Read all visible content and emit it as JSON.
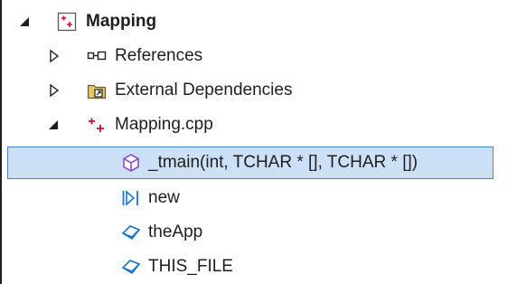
{
  "tree": {
    "items": [
      {
        "label": "Mapping",
        "icon": "cpp-project-icon",
        "expander": "expanded"
      },
      {
        "label": "References",
        "icon": "references-icon",
        "expander": "collapsed"
      },
      {
        "label": "External Dependencies",
        "icon": "external-dependencies-icon",
        "expander": "collapsed"
      },
      {
        "label": "Mapping.cpp",
        "icon": "cpp-file-icon",
        "expander": "expanded"
      },
      {
        "label": "_tmain(int, TCHAR * [], TCHAR * [])",
        "icon": "function-icon",
        "selected": true
      },
      {
        "label": "new",
        "icon": "operator-icon"
      },
      {
        "label": "theApp",
        "icon": "variable-icon"
      },
      {
        "label": "THIS_FILE",
        "icon": "variable-icon"
      }
    ]
  },
  "colors": {
    "selection_background": "#cce0f7",
    "selection_border": "#4f7fc4",
    "cpp_red": "#c8102e",
    "function_purple": "#8a50c8",
    "variable_blue": "#1f73c9",
    "expander_dark": "#1e1e1e"
  }
}
